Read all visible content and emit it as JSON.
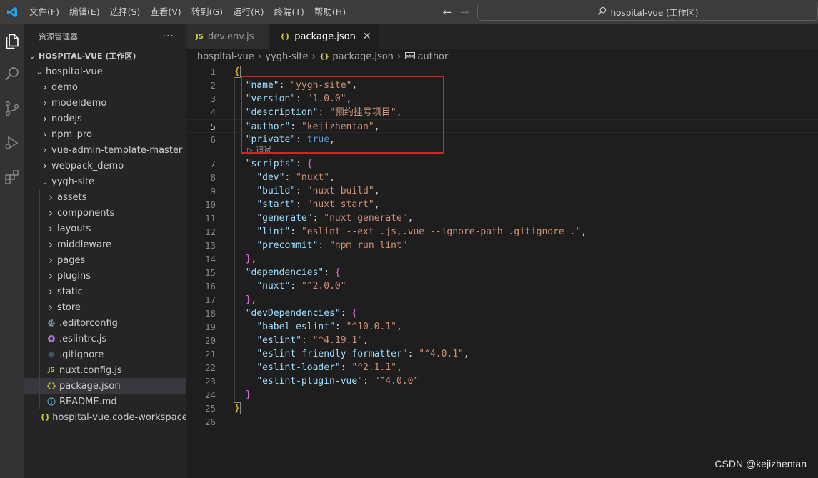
{
  "menu": [
    "文件(F)",
    "编辑(E)",
    "选择(S)",
    "查看(V)",
    "转到(G)",
    "运行(R)",
    "终端(T)",
    "帮助(H)"
  ],
  "command_center": "hospital-vue (工作区)",
  "sidebar": {
    "title": "资源管理器",
    "more": "···",
    "workspace": "HOSPITAL-VUE (工作区)",
    "tree": [
      {
        "label": "hospital-vue",
        "depth": 1,
        "type": "folder-open",
        "icon": ""
      },
      {
        "label": "demo",
        "depth": 2,
        "type": "folder",
        "icon": ""
      },
      {
        "label": "modeldemo",
        "depth": 2,
        "type": "folder",
        "icon": ""
      },
      {
        "label": "nodejs",
        "depth": 2,
        "type": "folder",
        "icon": ""
      },
      {
        "label": "npm_pro",
        "depth": 2,
        "type": "folder",
        "icon": ""
      },
      {
        "label": "vue-admin-template-master",
        "depth": 2,
        "type": "folder",
        "icon": ""
      },
      {
        "label": "webpack_demo",
        "depth": 2,
        "type": "folder",
        "icon": ""
      },
      {
        "label": "yygh-site",
        "depth": 2,
        "type": "folder-open",
        "icon": ""
      },
      {
        "label": "assets",
        "depth": 3,
        "type": "folder",
        "icon": ""
      },
      {
        "label": "components",
        "depth": 3,
        "type": "folder",
        "icon": ""
      },
      {
        "label": "layouts",
        "depth": 3,
        "type": "folder",
        "icon": ""
      },
      {
        "label": "middleware",
        "depth": 3,
        "type": "folder",
        "icon": ""
      },
      {
        "label": "pages",
        "depth": 3,
        "type": "folder",
        "icon": ""
      },
      {
        "label": "plugins",
        "depth": 3,
        "type": "folder",
        "icon": ""
      },
      {
        "label": "static",
        "depth": 3,
        "type": "folder",
        "icon": ""
      },
      {
        "label": "store",
        "depth": 3,
        "type": "folder",
        "icon": ""
      },
      {
        "label": ".editorconfig",
        "depth": 3,
        "type": "file",
        "icon": "gear"
      },
      {
        "label": ".eslintrc.js",
        "depth": 3,
        "type": "file",
        "icon": "eslint"
      },
      {
        "label": ".gitignore",
        "depth": 3,
        "type": "file",
        "icon": "git"
      },
      {
        "label": "nuxt.config.js",
        "depth": 3,
        "type": "file",
        "icon": "js"
      },
      {
        "label": "package.json",
        "depth": 3,
        "type": "file",
        "icon": "json",
        "selected": true
      },
      {
        "label": "README.md",
        "depth": 3,
        "type": "file",
        "icon": "info"
      },
      {
        "label": "hospital-vue.code-workspace",
        "depth": 2,
        "type": "file",
        "icon": "json"
      }
    ]
  },
  "tabs": [
    {
      "label": "dev.env.js",
      "icon_text": "JS",
      "icon": "js",
      "active": false
    },
    {
      "label": "package.json",
      "icon_text": "{}",
      "icon": "json",
      "active": true
    }
  ],
  "tab_close": "✕",
  "breadcrumb": [
    {
      "label": "hospital-vue",
      "icon": ""
    },
    {
      "label": "yygh-site",
      "icon": ""
    },
    {
      "label": "package.json",
      "icon": "json"
    },
    {
      "label": "author",
      "icon": "string"
    }
  ],
  "codelens": "▷ 调试",
  "code_lines": [
    [
      [
        "{",
        "br1"
      ]
    ],
    [
      [
        "  ",
        "p"
      ],
      [
        "\"name\"",
        "k"
      ],
      [
        ": ",
        "p"
      ],
      [
        "\"yygh-site\"",
        "s"
      ],
      [
        ",",
        "p"
      ]
    ],
    [
      [
        "  ",
        "p"
      ],
      [
        "\"version\"",
        "k"
      ],
      [
        ": ",
        "p"
      ],
      [
        "\"1.0.0\"",
        "s"
      ],
      [
        ",",
        "p"
      ]
    ],
    [
      [
        "  ",
        "p"
      ],
      [
        "\"description\"",
        "k"
      ],
      [
        ": ",
        "p"
      ],
      [
        "\"预约挂号项目\"",
        "s"
      ],
      [
        ",",
        "p"
      ]
    ],
    [
      [
        "  ",
        "p"
      ],
      [
        "\"author\"",
        "k"
      ],
      [
        ": ",
        "p"
      ],
      [
        "\"kejizhentan\"",
        "s"
      ],
      [
        ",",
        "p"
      ]
    ],
    [
      [
        "  ",
        "p"
      ],
      [
        "\"private\"",
        "k"
      ],
      [
        ": ",
        "p"
      ],
      [
        "true",
        "b"
      ],
      [
        ",",
        "p"
      ]
    ],
    [
      [
        "  ",
        "p"
      ],
      [
        "\"scripts\"",
        "k"
      ],
      [
        ": ",
        "p"
      ],
      [
        "{",
        "br2"
      ]
    ],
    [
      [
        "    ",
        "p"
      ],
      [
        "\"dev\"",
        "k"
      ],
      [
        ": ",
        "p"
      ],
      [
        "\"nuxt\"",
        "s"
      ],
      [
        ",",
        "p"
      ]
    ],
    [
      [
        "    ",
        "p"
      ],
      [
        "\"build\"",
        "k"
      ],
      [
        ": ",
        "p"
      ],
      [
        "\"nuxt build\"",
        "s"
      ],
      [
        ",",
        "p"
      ]
    ],
    [
      [
        "    ",
        "p"
      ],
      [
        "\"start\"",
        "k"
      ],
      [
        ": ",
        "p"
      ],
      [
        "\"nuxt start\"",
        "s"
      ],
      [
        ",",
        "p"
      ]
    ],
    [
      [
        "    ",
        "p"
      ],
      [
        "\"generate\"",
        "k"
      ],
      [
        ": ",
        "p"
      ],
      [
        "\"nuxt generate\"",
        "s"
      ],
      [
        ",",
        "p"
      ]
    ],
    [
      [
        "    ",
        "p"
      ],
      [
        "\"lint\"",
        "k"
      ],
      [
        ": ",
        "p"
      ],
      [
        "\"eslint --ext .js,.vue --ignore-path .gitignore .\"",
        "s"
      ],
      [
        ",",
        "p"
      ]
    ],
    [
      [
        "    ",
        "p"
      ],
      [
        "\"precommit\"",
        "k"
      ],
      [
        ": ",
        "p"
      ],
      [
        "\"npm run lint\"",
        "s"
      ]
    ],
    [
      [
        "  ",
        "p"
      ],
      [
        "}",
        "br2"
      ],
      [
        ",",
        "p"
      ]
    ],
    [
      [
        "  ",
        "p"
      ],
      [
        "\"dependencies\"",
        "k"
      ],
      [
        ": ",
        "p"
      ],
      [
        "{",
        "br2"
      ]
    ],
    [
      [
        "    ",
        "p"
      ],
      [
        "\"nuxt\"",
        "k"
      ],
      [
        ": ",
        "p"
      ],
      [
        "\"^2.0.0\"",
        "s"
      ]
    ],
    [
      [
        "  ",
        "p"
      ],
      [
        "}",
        "br2"
      ],
      [
        ",",
        "p"
      ]
    ],
    [
      [
        "  ",
        "p"
      ],
      [
        "\"devDependencies\"",
        "k"
      ],
      [
        ": ",
        "p"
      ],
      [
        "{",
        "br2"
      ]
    ],
    [
      [
        "    ",
        "p"
      ],
      [
        "\"babel-eslint\"",
        "k"
      ],
      [
        ": ",
        "p"
      ],
      [
        "\"^10.0.1\"",
        "s"
      ],
      [
        ",",
        "p"
      ]
    ],
    [
      [
        "    ",
        "p"
      ],
      [
        "\"eslint\"",
        "k"
      ],
      [
        ": ",
        "p"
      ],
      [
        "\"^4.19.1\"",
        "s"
      ],
      [
        ",",
        "p"
      ]
    ],
    [
      [
        "    ",
        "p"
      ],
      [
        "\"eslint-friendly-formatter\"",
        "k"
      ],
      [
        ": ",
        "p"
      ],
      [
        "\"^4.0.1\"",
        "s"
      ],
      [
        ",",
        "p"
      ]
    ],
    [
      [
        "    ",
        "p"
      ],
      [
        "\"eslint-loader\"",
        "k"
      ],
      [
        ": ",
        "p"
      ],
      [
        "\"^2.1.1\"",
        "s"
      ],
      [
        ",",
        "p"
      ]
    ],
    [
      [
        "    ",
        "p"
      ],
      [
        "\"eslint-plugin-vue\"",
        "k"
      ],
      [
        ": ",
        "p"
      ],
      [
        "\"^4.0.0\"",
        "s"
      ]
    ],
    [
      [
        "  ",
        "p"
      ],
      [
        "}",
        "br2"
      ]
    ],
    [
      [
        "}",
        "br1"
      ]
    ],
    []
  ],
  "current_line": 5,
  "watermark": "CSDN @kejizhentan",
  "colors": {
    "titlebar": "#3c3c3c",
    "activitybar": "#333333",
    "sidebar": "#252526",
    "editor": "#1e1e1e",
    "json_key": "#9cdcfe",
    "json_string": "#ce9178",
    "json_keyword": "#569cd6",
    "highlight_box": "#e0201b",
    "vscode_blue": "#23a9f2"
  }
}
